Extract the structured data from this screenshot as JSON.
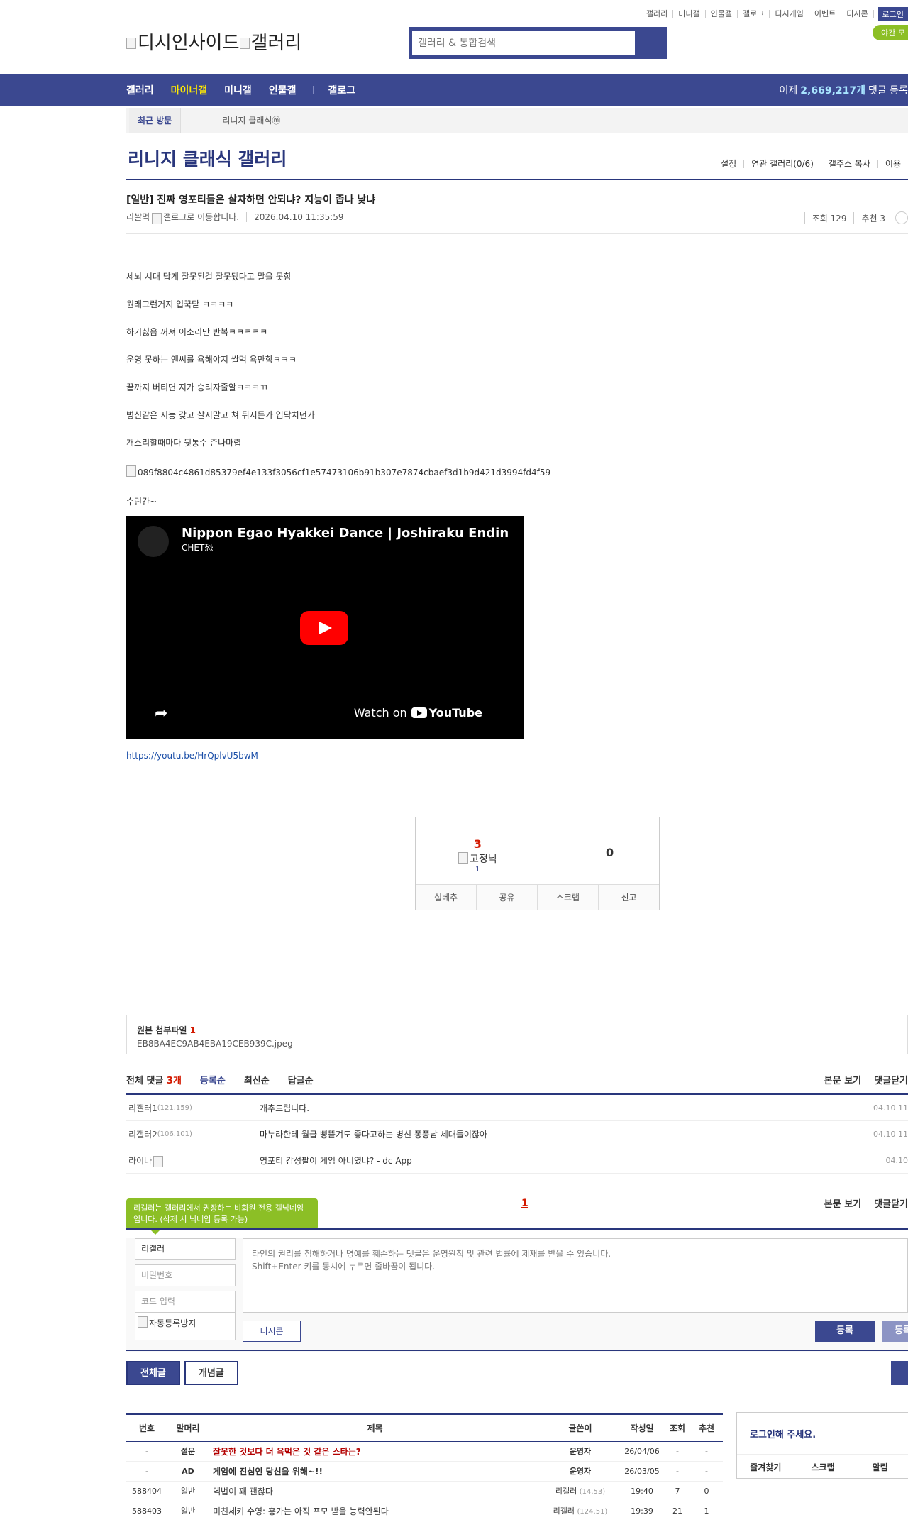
{
  "util_links": [
    "갤러리",
    "미니갤",
    "인물갤",
    "갤로그",
    "디시게임",
    "이벤트",
    "디시콘"
  ],
  "login_label": "로그인",
  "night_mode": "야간 모",
  "logo": {
    "alt1": "디시인사이드",
    "alt2": "갤러리"
  },
  "search": {
    "placeholder": "갤러리 & 통합검색"
  },
  "nav": {
    "items": [
      "갤러리",
      "마이너갤",
      "미니갤",
      "인물갤",
      "갤로그"
    ],
    "active": "마이너갤",
    "stat_prefix": "어제",
    "stat_value": "2,669,217개",
    "stat_suffix": "댓글 등록"
  },
  "visit": {
    "title": "최근 방문",
    "item": "리니지 클래식ⓜ"
  },
  "gallery": {
    "title": "리니지 클래식 갤러리",
    "links": [
      "설정",
      "연관 갤러리(0/6)",
      "갤주소 복사",
      "이용"
    ]
  },
  "post": {
    "title": "[일반] 진짜 영포티들은 살자하면 안되냐? 지능이 좁나 낮냐",
    "author": "리쌀먹",
    "gallog_alt": "갤로그로 이동합니다.",
    "date": "2026.04.10 11:35:59",
    "views": "조회 129",
    "recommend": "추천 3",
    "lines": [
      "세뇌 시대 답게 잘못된걸 잘못됐다고 말을 못함",
      "원래그런거지 입꾹닫 ㅋㅋㅋㅋ",
      "하기싫음 꺼져 이소리만 반복ㅋㅋㅋㅋㅋ",
      "운영 못하는 엔씨를 욕해야지 쌀먹 욕만함ㅋㅋㅋ",
      "끝까지 버티면 지가 승리자줄알ㅋㅋㅋㄲ",
      "병신같은 지능 갖고 살지말고 쳐 뒤지든가 입닥치던가",
      "개소리할때마다 뒷통수 존나마렵"
    ],
    "image_alt": "089f8804c4861d85379ef4e133f3056cf1e57473106b91b307e7874cbaef3d1b9d421d3994fd4f59",
    "after_image": "수린간~",
    "video": {
      "title": "Nippon Egao Hyakkei Dance | Joshiraku Ending OST",
      "channel": "CHET恐",
      "watch_on": "Watch on",
      "brand": "YouTube"
    },
    "link": "https://youtu.be/HrQplvU5bwM"
  },
  "recommend_box": {
    "up": "3",
    "fixed_alt": "고정닉",
    "fixed_count": "1",
    "down": "0",
    "buttons": [
      "실베추",
      "공유",
      "스크랩",
      "신고"
    ]
  },
  "attachment": {
    "label": "원본 첨부파일",
    "count": "1",
    "file": "EB8BA4EC9AB4EBA19CEB939C.jpeg"
  },
  "comments_header": {
    "total_label": "전체 댓글",
    "total_count": "3개",
    "sorts": [
      "등록순",
      "최신순",
      "답글순"
    ],
    "right": [
      "본문 보기",
      "댓글닫기"
    ]
  },
  "comments": [
    {
      "nick": "리갤러1",
      "ip": "(121.159)",
      "text": "개추드립니다.",
      "time": "04.10 11"
    },
    {
      "nick": "리갤러2",
      "ip": "(106.101)",
      "text": "마누라한테 월급 삥뜯겨도 좋다고하는 병신 퐁퐁남 세대들이잖아",
      "time": "04.10 11"
    },
    {
      "nick": "라이나",
      "ip": "",
      "text": "영포티 감성팔이 게임 아니였냐? - dc App",
      "time": "04.10"
    }
  ],
  "page": "1",
  "tooltip": "리갤러는 갤러리에서 권장하는 비회원 전용 갤닉네임입니다. (삭제 시 닉네임 등록 가능)",
  "write": {
    "nick_value": "리갤러",
    "password_placeholder": "비밀번호",
    "code_placeholder": "코드 입력",
    "captcha_alt": "자동등록방지",
    "textarea_placeholder": "타인의 권리를 침해하거나 명예를 훼손하는 댓글은 운영원칙 및 관련 법률에 제재를 받을 수 있습니다.\nShift+Enter 키를 동시에 누르면 줄바꿈이 됩니다.",
    "dccon": "디시콘",
    "submit": "등록",
    "submit2": "등록"
  },
  "list_buttons": [
    "전체글",
    "개념글"
  ],
  "table": {
    "headers": [
      "번호",
      "말머리",
      "제목",
      "글쓴이",
      "작성일",
      "조회",
      "추천"
    ],
    "rows": [
      {
        "num": "-",
        "head": "설문",
        "title": "잘못한 것보다 더 욕먹은 것 같은 스타는?",
        "writer": "운영자",
        "ip": "",
        "date": "26/04/06",
        "views": "-",
        "rec": "-"
      },
      {
        "num": "-",
        "head": "AD",
        "title": "게임에 진심인 당신을 위해~!!",
        "writer": "운영자",
        "ip": "",
        "date": "26/03/05",
        "views": "-",
        "rec": "-"
      },
      {
        "num": "588404",
        "head": "일반",
        "title": "뎩법이 꽤 괜찮다",
        "writer": "리갤러",
        "ip": "(14.53)",
        "date": "19:40",
        "views": "7",
        "rec": "0"
      },
      {
        "num": "588403",
        "head": "일반",
        "title": "미친세키 수영: 홍가는 아직 프모 받을 능력안된다",
        "writer": "리갤러",
        "ip": "(124.51)",
        "date": "19:39",
        "views": "21",
        "rec": "1"
      }
    ]
  },
  "login_box": {
    "title": "로그인해 주세요.",
    "links": [
      "즐겨찾기",
      "스크랩",
      "알림"
    ]
  },
  "colors": {
    "navy": "#3b4890",
    "dark_navy": "#29367c",
    "green": "#8cbf26",
    "red": "#d31900",
    "yellow": "#ffea00"
  }
}
